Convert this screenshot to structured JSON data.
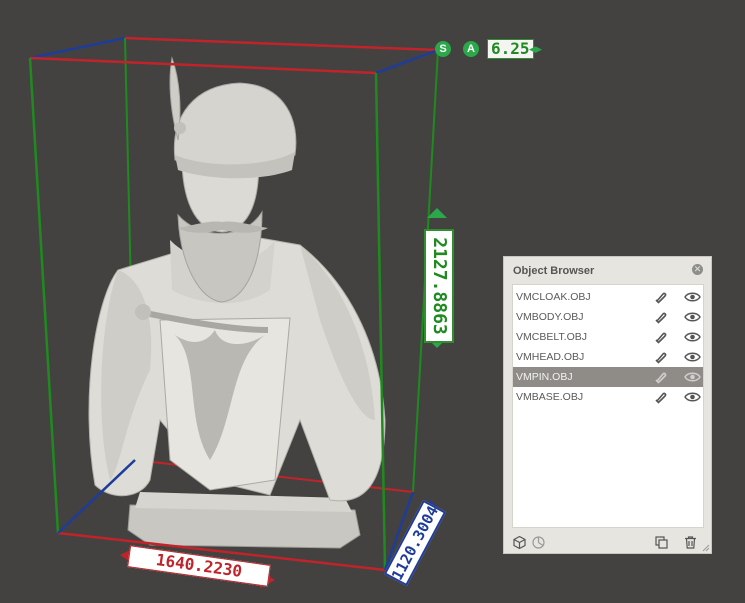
{
  "scale_widget": {
    "s_label": "S",
    "a_label": "A",
    "value": "6.25",
    "arrows": "◂▸"
  },
  "dimensions": {
    "height": "2127.8863",
    "width": "1640.2230",
    "depth": "1120.3004"
  },
  "object_browser": {
    "title": "Object Browser",
    "close": "✕",
    "items": [
      {
        "name": "VMCLOAK.OBJ"
      },
      {
        "name": "VMBODY.OBJ"
      },
      {
        "name": "VMCBELT.OBJ"
      },
      {
        "name": "VMHEAD.OBJ"
      },
      {
        "name": "VMPIN.OBJ",
        "selected": true
      },
      {
        "name": "VMBASE.OBJ"
      }
    ],
    "row_icons": [
      "magnet-icon",
      "eye-icon"
    ],
    "footer_icons": [
      "cube-icon",
      "pie-icon",
      "duplicate-icon",
      "trash-icon"
    ]
  },
  "colors": {
    "background": "#434240",
    "x_axis": "#c0242a",
    "y_axis": "#1f8a1f",
    "z_axis": "#1e3c9a",
    "selected_row": "#8f8c88"
  }
}
